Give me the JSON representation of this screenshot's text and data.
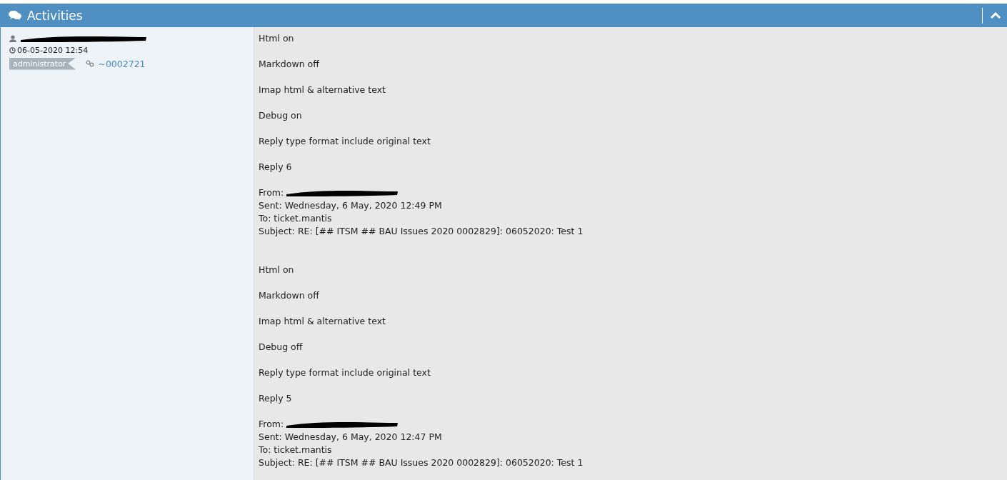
{
  "panel": {
    "title": "Activities",
    "collapsed": false
  },
  "activity": {
    "timestamp": "06-05-2020 12:54",
    "role": "administrator",
    "link": "~0002721"
  },
  "body": [
    {
      "kind": "para",
      "lines": [
        "Html on"
      ]
    },
    {
      "kind": "para",
      "lines": [
        "Markdown off"
      ]
    },
    {
      "kind": "para",
      "lines": [
        "Imap html & alternative text"
      ]
    },
    {
      "kind": "para",
      "lines": [
        "Debug on"
      ]
    },
    {
      "kind": "para",
      "lines": [
        "Reply type format include original text"
      ]
    },
    {
      "kind": "para",
      "lines": [
        "Reply 6"
      ]
    },
    {
      "kind": "header",
      "from": "From:",
      "lines": [
        "Sent: Wednesday, 6 May, 2020 12:49 PM",
        "To: ticket.mantis",
        "Subject: RE: [## ITSM ## BAU Issues 2020 0002829]: 06052020: Test 1"
      ]
    },
    {
      "kind": "para",
      "lines": [
        "Html on"
      ]
    },
    {
      "kind": "para",
      "lines": [
        "Markdown off"
      ]
    },
    {
      "kind": "para",
      "lines": [
        "Imap html & alternative text"
      ]
    },
    {
      "kind": "para",
      "lines": [
        "Debug off"
      ]
    },
    {
      "kind": "para",
      "lines": [
        "Reply type format include original text"
      ]
    },
    {
      "kind": "para",
      "lines": [
        "Reply 5"
      ]
    },
    {
      "kind": "header",
      "from": "From:",
      "lines": [
        "Sent: Wednesday, 6 May, 2020 12:47 PM",
        "To: ticket.mantis",
        "Subject: RE: [## ITSM ## BAU Issues 2020 0002829]: 06052020: Test 1"
      ]
    }
  ]
}
